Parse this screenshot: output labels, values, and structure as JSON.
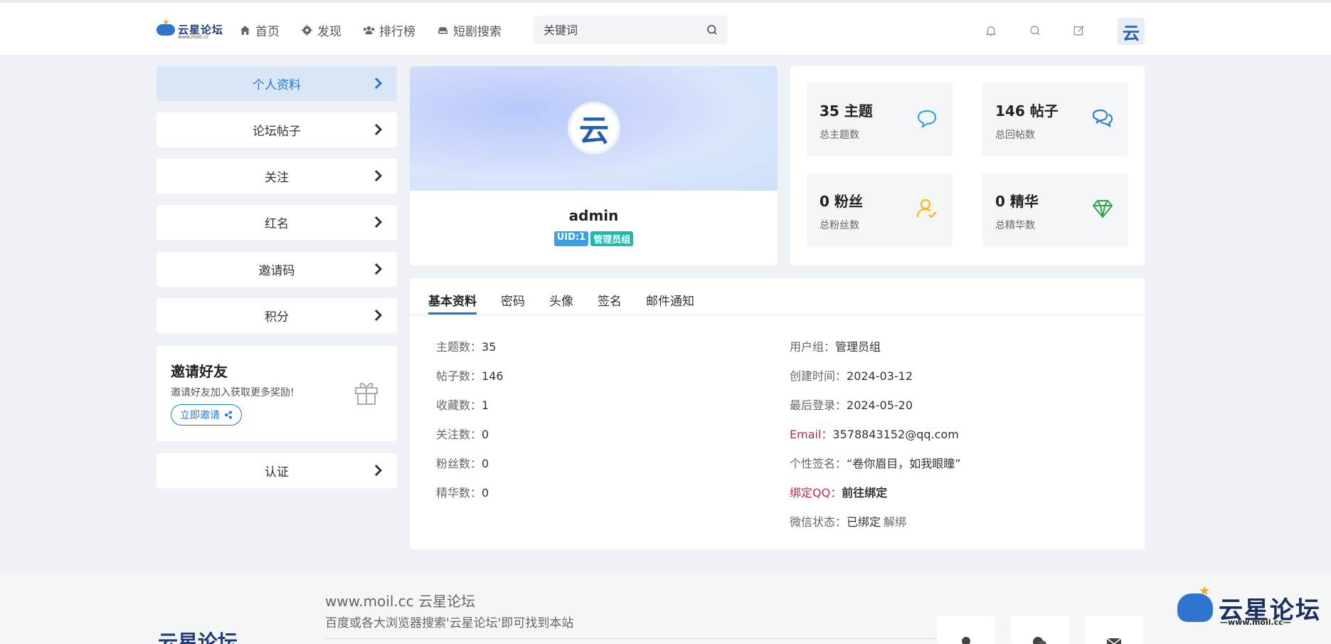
{
  "header": {
    "logo_text": "云星论坛",
    "logo_sub": "www.moil.cc",
    "nav": [
      {
        "label": "首页",
        "icon": "home-icon"
      },
      {
        "label": "发现",
        "icon": "gear-icon"
      },
      {
        "label": "排行榜",
        "icon": "users-icon"
      },
      {
        "label": "短剧搜索",
        "icon": "drive-icon"
      }
    ],
    "search_placeholder": "关键词",
    "avatar_glyph": "云"
  },
  "sidebar": {
    "items": [
      {
        "label": "个人资料"
      },
      {
        "label": "论坛帖子"
      },
      {
        "label": "关注"
      },
      {
        "label": "红名"
      },
      {
        "label": "邀请码"
      },
      {
        "label": "积分"
      }
    ],
    "invite": {
      "title": "邀请好友",
      "desc": "邀请好友加入获取更多奖励!",
      "button": "立即邀请"
    },
    "verify": "认证"
  },
  "profile": {
    "avatar_glyph": "云",
    "name": "admin",
    "uid_badge": "UID:1",
    "group_badge": "管理员组"
  },
  "stats": [
    {
      "value": "35 主题",
      "label": "总主题数",
      "icon": "comment-icon",
      "color": "#2a9fd6"
    },
    {
      "value": "146 帖子",
      "label": "总回帖数",
      "icon": "comments-icon",
      "color": "#1e79d6"
    },
    {
      "value": "0 粉丝",
      "label": "总粉丝数",
      "icon": "user-check-icon",
      "color": "#f5b400"
    },
    {
      "value": "0 精华",
      "label": "总精华数",
      "icon": "diamond-icon",
      "color": "#2aa84a"
    }
  ],
  "tabs": [
    "基本资料",
    "密码",
    "头像",
    "签名",
    "邮件通知"
  ],
  "info_left": [
    {
      "key": "主题数：",
      "value": "35"
    },
    {
      "key": "帖子数：",
      "value": "146"
    },
    {
      "key": "收藏数：",
      "value": "1"
    },
    {
      "key": "关注数：",
      "value": "0"
    },
    {
      "key": "粉丝数：",
      "value": "0"
    },
    {
      "key": "精华数：",
      "value": "0"
    }
  ],
  "info_right": [
    {
      "key": "用户组：",
      "value": "管理员组"
    },
    {
      "key": "创建时间：",
      "value": "2024-03-12"
    },
    {
      "key": "最后登录：",
      "value": "2024-05-20"
    },
    {
      "key": "Email：",
      "value": "3578843152@qq.com"
    },
    {
      "key": "个性签名：",
      "value": "“卷你眉目，如我眼瞳”"
    },
    {
      "key": "绑定QQ：",
      "value": "前往绑定"
    },
    {
      "key": "微信状态：",
      "value": "已绑定",
      "link": "解绑"
    }
  ],
  "footer": {
    "title": "www.moil.cc 云星论坛",
    "sub": "百度或各大浏览器搜索'云星论坛'即可找到本站",
    "logo_text": "云星论坛"
  },
  "watermark_logo": {
    "text": "云星论坛",
    "url": "—www.moil.cc—"
  },
  "colors": {
    "accent": "#1e79d6",
    "red_label": "#c7254e"
  }
}
